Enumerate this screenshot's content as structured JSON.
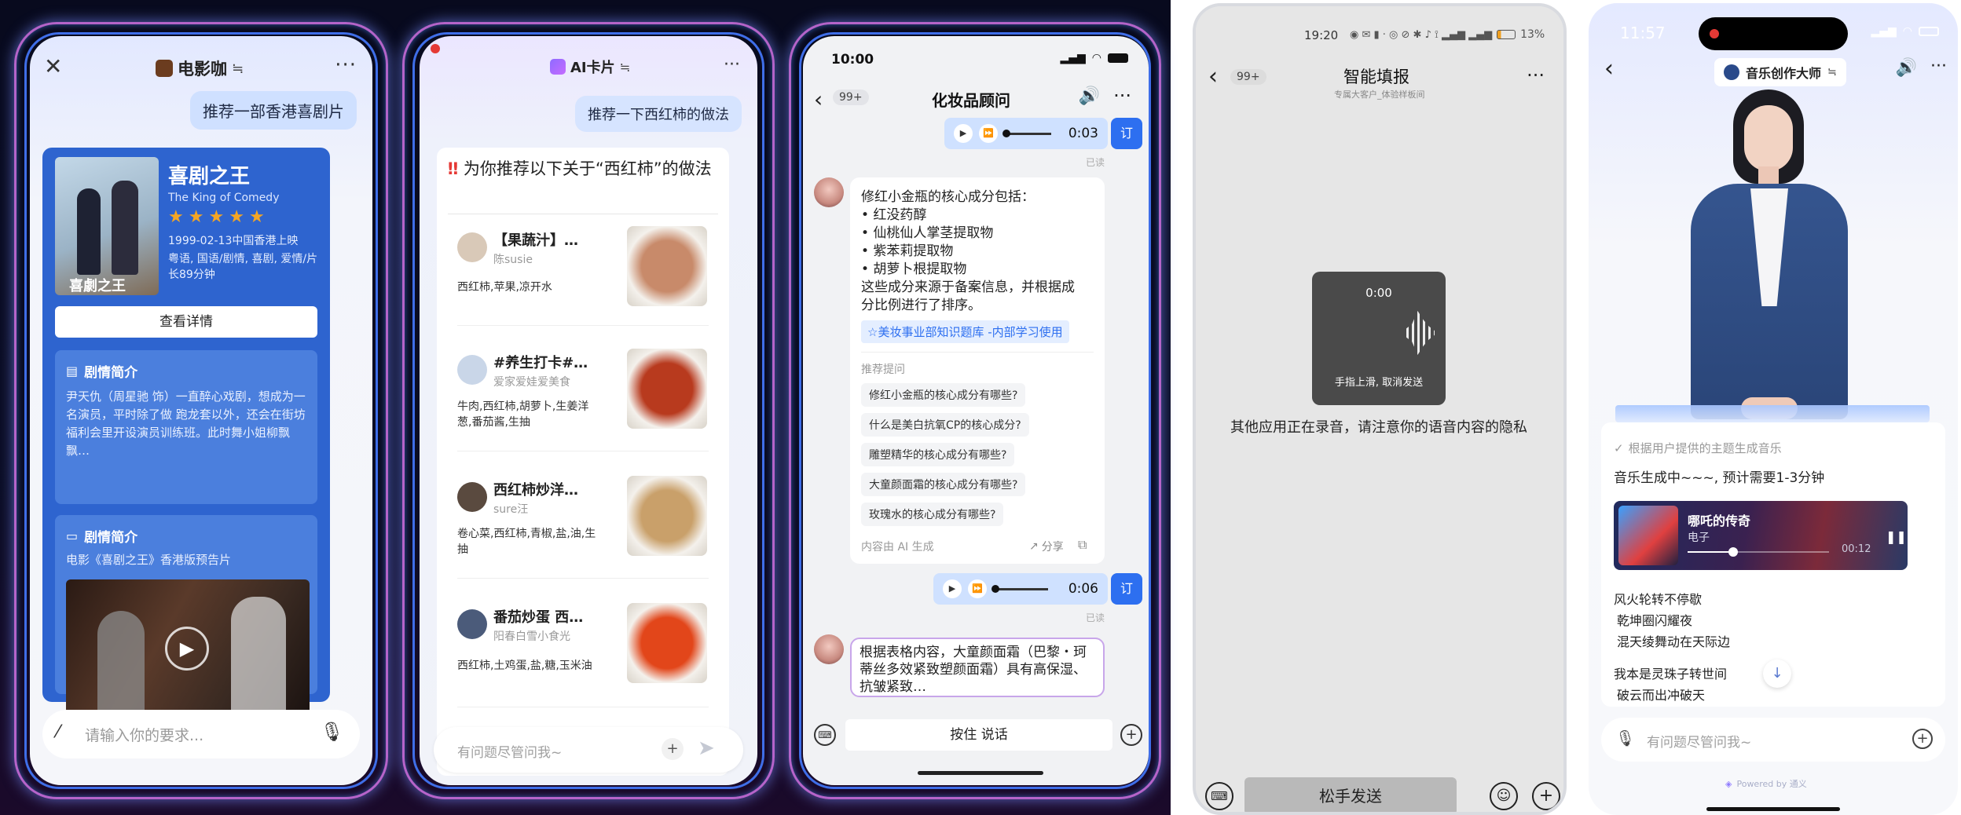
{
  "colors": {
    "accent_blue": "#3a74f2",
    "movie_card_blue": "#2e64cf",
    "star": "#f5a623",
    "red_mark": "#e53935",
    "dark_bg": "#0b0d25"
  },
  "p1": {
    "title": "电影咖",
    "title_suffix": "≒",
    "user_msg": "推荐一部香港喜剧片",
    "movie": {
      "title": "喜剧之王",
      "subtitle": "The King of Comedy",
      "stars": 5,
      "release": "1999-02-13中国香港上映",
      "info": "粤语, 国语/剧情, 喜剧, 爱情/片长89分钟",
      "poster_text": "喜劇之王",
      "detail_btn": "查看详情"
    },
    "plot_title": "剧情简介",
    "plot_text": "尹天仇（周星驰 饰）一直醉心戏剧，想成为一名演员，平时除了做 跑龙套以外，还会在街坊福利会里开设演员训练班。此时舞小姐柳飘飘…",
    "video_title": "剧情简介",
    "video_caption": "电影《喜剧之王》香港版预告片",
    "input_placeholder": "请输入你的要求..."
  },
  "p2": {
    "title": "AI卡片",
    "title_suffix": "≒",
    "user_msg": "推荐一下西红柿的做法",
    "heading_mark": "‼",
    "heading": "为你推荐以下关于“西红柿”的做法",
    "recipes": [
      {
        "title": "【果蔬汁】…",
        "author": "陈susie",
        "ingredients": "西红柿,苹果,凉开水",
        "food_color": "#c88a6a"
      },
      {
        "title": "#养生打卡#…",
        "author": "爱家爱娃爱美食",
        "ingredients": "牛肉,西红柿,胡萝卜,生姜洋葱,番茄酱,生抽",
        "food_color": "#b83a1e"
      },
      {
        "title": "西红柿炒洋…",
        "author": "sure汪",
        "ingredients": "卷心菜,西红柿,青椒,盐,油,生抽",
        "food_color": "#c9a06a"
      },
      {
        "title": "番茄炒蛋 西…",
        "author": "阳春白雪小食光",
        "ingredients": "西红柿,土鸡蛋,盐,糖,玉米油",
        "food_color": "#e2461a"
      }
    ],
    "input_placeholder": "有问题尽管问我~"
  },
  "p3": {
    "time": "10:00",
    "back_badge": "99+",
    "title": "化妆品顾问",
    "voice1_time": "0:03",
    "voice_tag": "订",
    "read_label": "已读",
    "answer_lines": [
      "修红小金瓶的核心成分包括：",
      "• 红没药醇",
      "• 仙桃仙人掌茎提取物",
      "• 紫苯莉提取物",
      "• 胡萝卜根提取物",
      "这些成分来源于备案信息，并根据成",
      "分比例进行了排序。"
    ],
    "kb_tag": "☆美妆事业部知识题库 -内部学习使用",
    "suggest_label": "推荐提问",
    "suggestions": [
      "修红小金瓶的核心成分有哪些?",
      "什么是美白抗氧CP的核心成分?",
      "雕塑精华的核心成分有哪些?",
      "大童颜面霜的核心成分有哪些?",
      "玫瑰水的核心成分有哪些?"
    ],
    "ai_note": "内容由 AI 生成",
    "share": "分享",
    "voice2_time": "0:06",
    "answer2": "根据表格内容，大童颜面霜（巴黎・珂蒂丝多效紧致塑颜面霜）具有高保湿、抗皱紧致…",
    "hold_to_talk": "按住 说话"
  },
  "p4": {
    "status_time": "19:20",
    "battery": "13%",
    "back_badge": "99+",
    "title": "智能填报",
    "subtitle": "专属大客户_体验样板间",
    "rec_time": "0:00",
    "rec_hint": "手指上滑, 取消发送",
    "warning": "其他应用正在录音，请注意你的语音内容的隐私",
    "release_send": "松手发送"
  },
  "p5": {
    "time": "11:57",
    "title": "音乐创作大师",
    "title_suffix": "≒",
    "status_line": "根据用户提供的主题生成音乐",
    "gen_text": "音乐生成中~~~, 预计需要1-3分钟",
    "song_title": "哪吒的传奇",
    "song_genre": "电子",
    "song_time": "00:12",
    "song_progress": 0.32,
    "lyrics": [
      "风火轮转不停歇",
      "乾坤圈闪耀夜",
      "混天绫舞动在天际边",
      "",
      "我本是灵珠子转世间",
      "破云而出冲破天"
    ],
    "input_placeholder": "有问题尽管问我~",
    "powered": "Powered by 通义"
  }
}
